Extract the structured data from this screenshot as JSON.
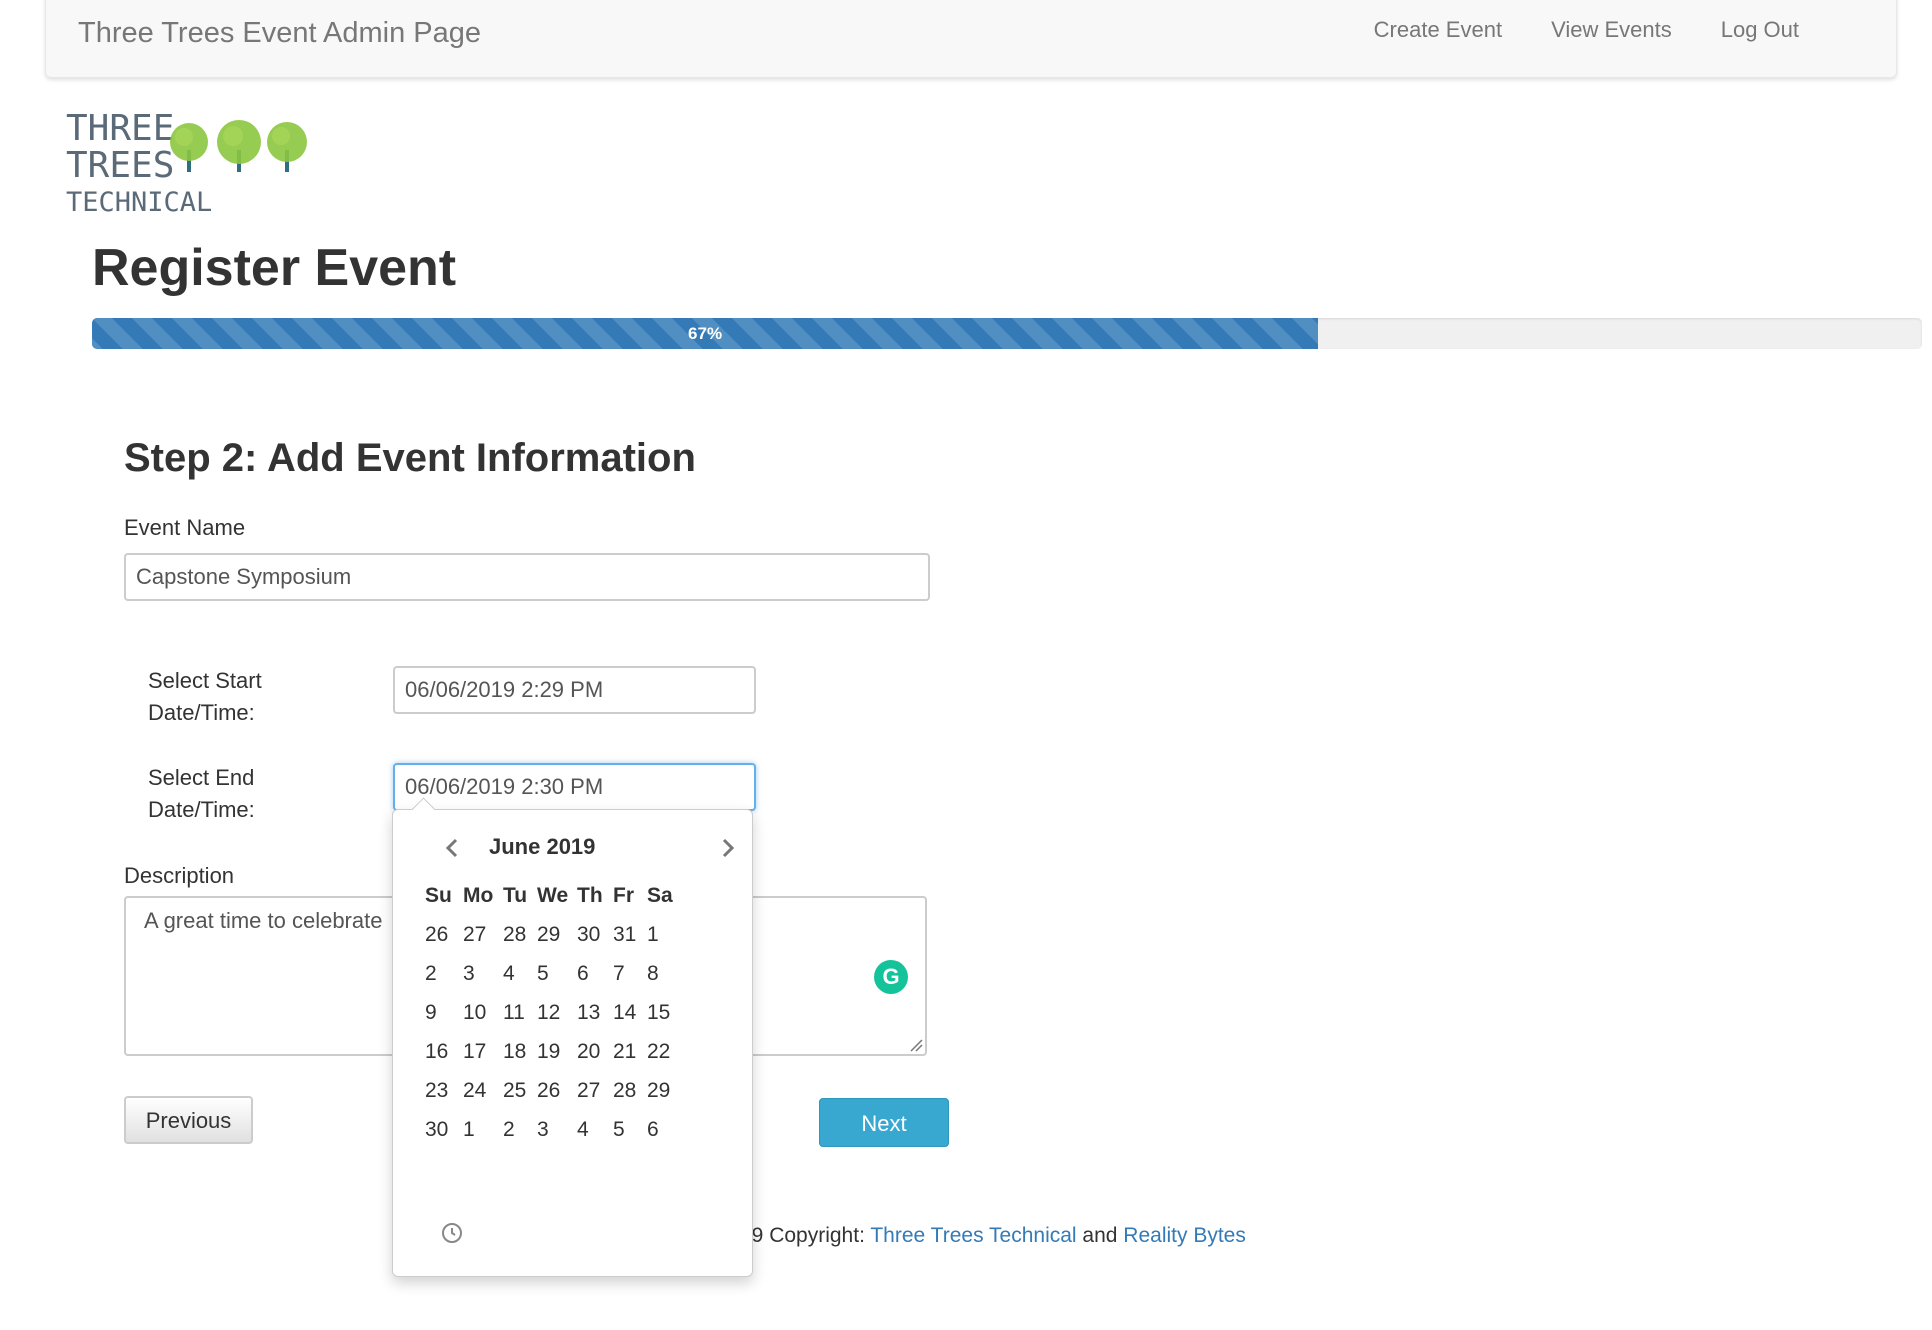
{
  "navbar": {
    "brand": "Three Trees Event Admin Page",
    "links": [
      "Create Event",
      "View Events",
      "Log Out"
    ]
  },
  "logo": {
    "line1": "THREE",
    "line2": "TREES",
    "line3": "TECHNICAL"
  },
  "page_title": "Register Event",
  "progress": {
    "value": 67,
    "label": "67%"
  },
  "step_title": "Step 2: Add Event Information",
  "form": {
    "event_name_label": "Event Name",
    "event_name_value": "Capstone Symposium",
    "start_label_line1": "Select Start",
    "start_label_line2": "Date/Time:",
    "start_value": "06/06/2019 2:29 PM",
    "end_label_line1": "Select End",
    "end_label_line2": "Date/Time:",
    "end_value": "06/06/2019 2:30 PM",
    "description_label": "Description",
    "description_value": "A great time to celebrate",
    "grammarly_icon": "G",
    "previous_label": "Previous",
    "next_label": "Next"
  },
  "footer": {
    "prefix": "19 Copyright: ",
    "link1": "Three Trees Technical",
    "middle": " and ",
    "link2": "Reality Bytes"
  },
  "datepicker": {
    "month_title": "June 2019",
    "weekdays": [
      "Su",
      "Mo",
      "Tu",
      "We",
      "Th",
      "Fr",
      "Sa"
    ],
    "weeks": [
      [
        "26",
        "27",
        "28",
        "29",
        "30",
        "31",
        "1"
      ],
      [
        "2",
        "3",
        "4",
        "5",
        "6",
        "7",
        "8"
      ],
      [
        "9",
        "10",
        "11",
        "12",
        "13",
        "14",
        "15"
      ],
      [
        "16",
        "17",
        "18",
        "19",
        "20",
        "21",
        "22"
      ],
      [
        "23",
        "24",
        "25",
        "26",
        "27",
        "28",
        "29"
      ],
      [
        "30",
        "1",
        "2",
        "3",
        "4",
        "5",
        "6"
      ]
    ],
    "icons": {
      "prev": "chevron-left-icon",
      "next": "chevron-right-icon",
      "time": "clock-icon"
    }
  },
  "colors": {
    "progress_bar": "#337ab7",
    "next_button": "#39a8d0",
    "link": "#337ab7",
    "focus_border": "#66afe9",
    "grammarly": "#15c39a"
  }
}
